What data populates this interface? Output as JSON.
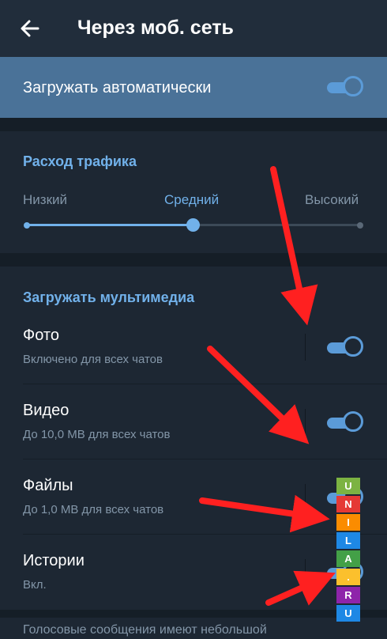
{
  "header": {
    "title": "Через моб. сеть",
    "back_icon": "arrow-left-icon"
  },
  "auto_download": {
    "label": "Загружать автоматически",
    "enabled": true
  },
  "traffic": {
    "title": "Расход трафика",
    "levels": [
      "Низкий",
      "Средний",
      "Высокий"
    ],
    "selected": "Средний",
    "selected_fraction": 0.5
  },
  "media": {
    "title": "Загружать мультимедиа",
    "items": [
      {
        "title": "Фото",
        "subtitle": "Включено для всех чатов",
        "enabled": true
      },
      {
        "title": "Видео",
        "subtitle": "До 10,0 MB для всех чатов",
        "enabled": true
      },
      {
        "title": "Файлы",
        "subtitle": "До 1,0 MB для всех чатов",
        "enabled": true
      },
      {
        "title": "Истории",
        "subtitle": "Вкл.",
        "enabled": true
      }
    ]
  },
  "footer": {
    "text": "Голосовые сообщения имеют небольшой"
  },
  "watermark": {
    "letters": [
      "U",
      "N",
      "I",
      "L",
      "A",
      ".",
      "R",
      "U"
    ],
    "colors": [
      "#1e88e5",
      "#3949ab",
      "#43a047",
      "#fbc02d",
      "#e53935",
      "#8e24aa",
      "#fb8c00",
      "#7cb342"
    ]
  },
  "colors": {
    "accent": "#71b1ea",
    "toggle_on": "#5b9bd8",
    "header_bg": "#212d3b",
    "row_highlight": "#4a7298",
    "background": "#1d2733",
    "annotation_arrows": "#ff2020"
  }
}
